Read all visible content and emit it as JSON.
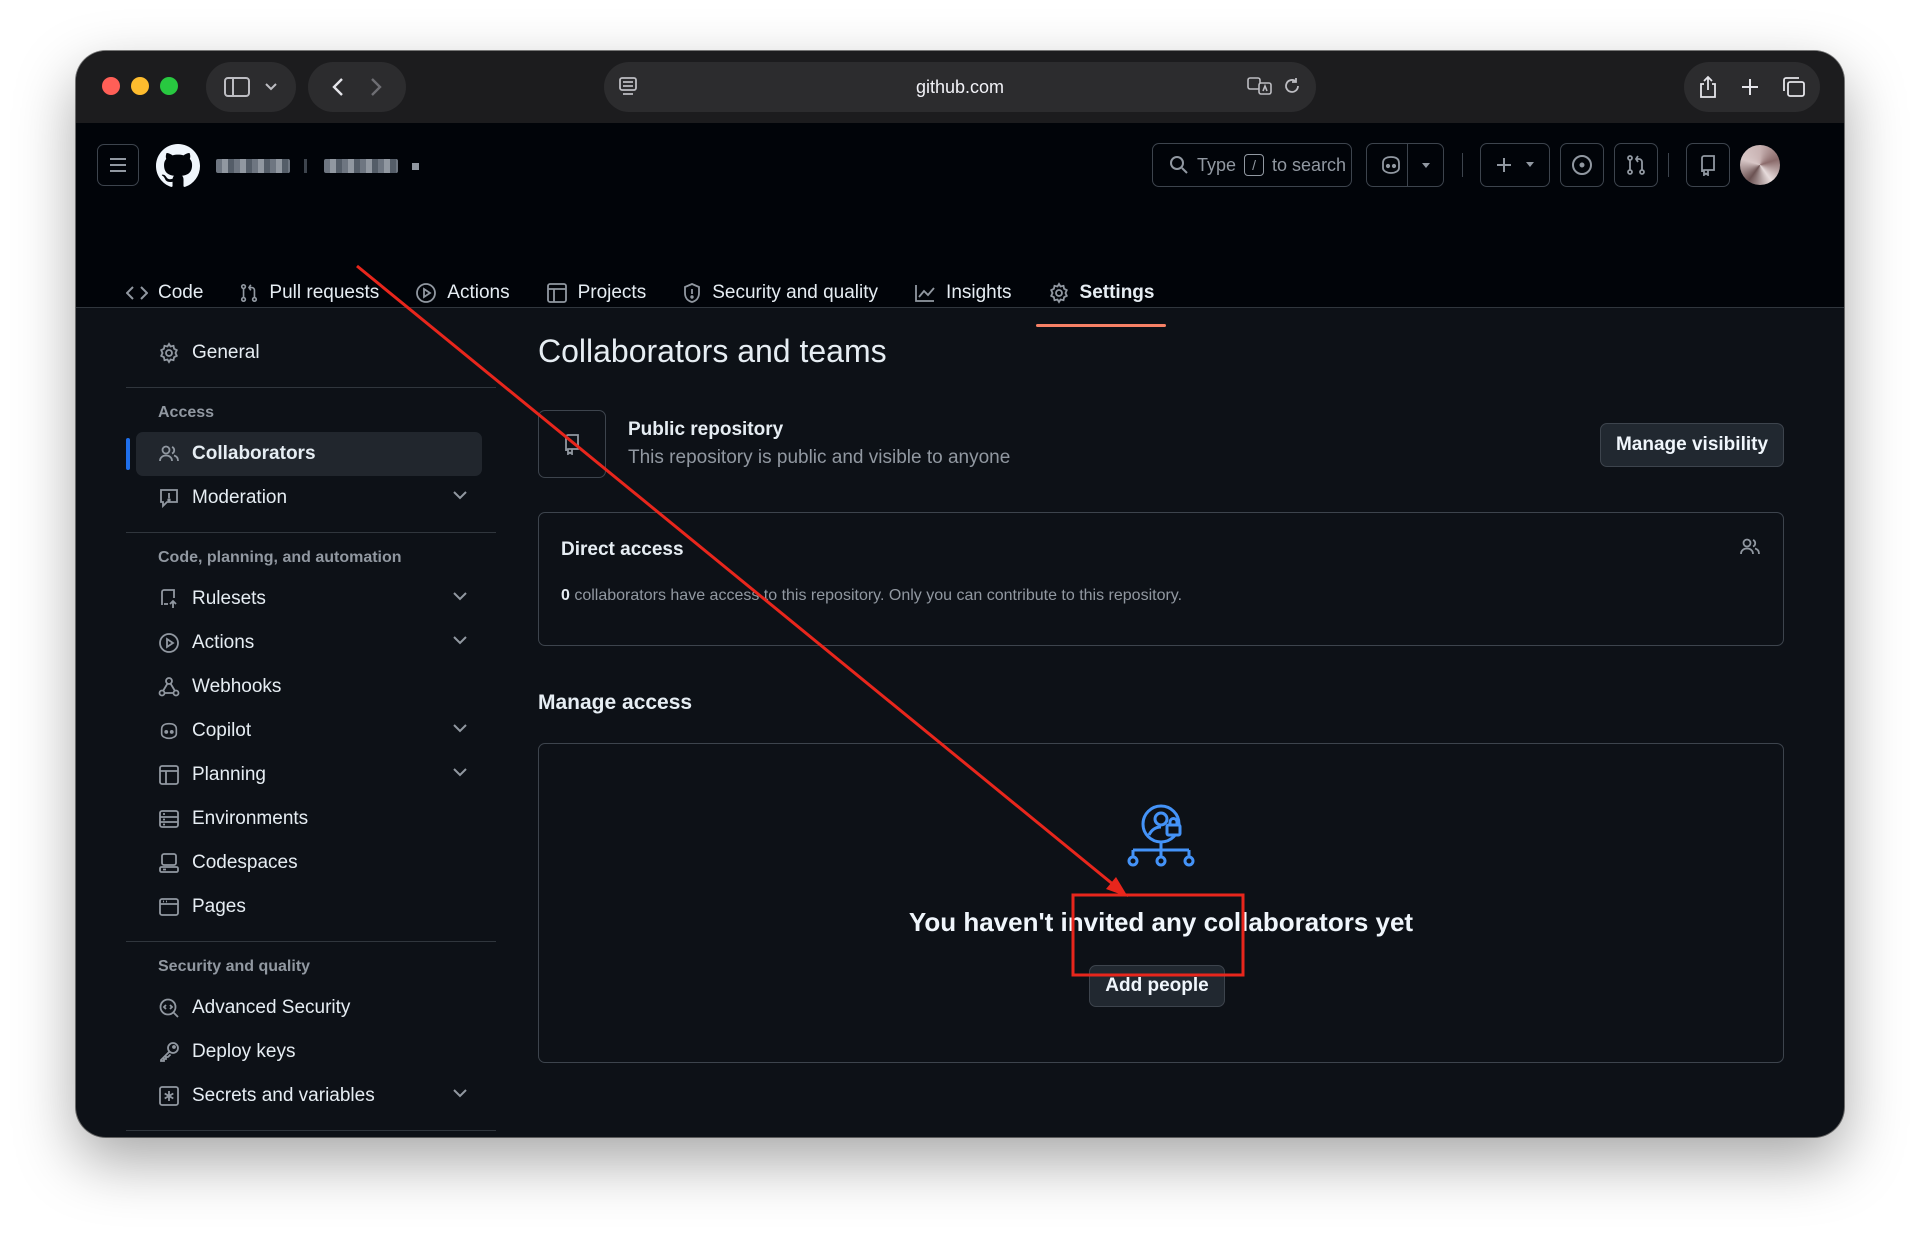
{
  "browser": {
    "url": "github.com"
  },
  "header": {
    "search_prefix": "Type",
    "search_key": "/",
    "search_suffix": "to search"
  },
  "tabs": [
    {
      "label": "Code",
      "icon": "code-icon"
    },
    {
      "label": "Pull requests",
      "icon": "pull-request-icon"
    },
    {
      "label": "Actions",
      "icon": "play-icon"
    },
    {
      "label": "Projects",
      "icon": "table-icon"
    },
    {
      "label": "Security and quality",
      "icon": "shield-icon"
    },
    {
      "label": "Insights",
      "icon": "graph-icon"
    },
    {
      "label": "Settings",
      "icon": "gear-icon",
      "active": true
    }
  ],
  "sidebar": {
    "general": "General",
    "access_heading": "Access",
    "collaborators": "Collaborators",
    "moderation": "Moderation",
    "code_heading": "Code, planning, and automation",
    "rulesets": "Rulesets",
    "actions": "Actions",
    "webhooks": "Webhooks",
    "copilot": "Copilot",
    "planning": "Planning",
    "environments": "Environments",
    "codespaces": "Codespaces",
    "pages": "Pages",
    "security_heading": "Security and quality",
    "advanced_security": "Advanced Security",
    "deploy_keys": "Deploy keys",
    "secrets": "Secrets and variables"
  },
  "main": {
    "title": "Collaborators and teams",
    "public_title": "Public repository",
    "public_desc": "This repository is public and visible to anyone",
    "manage_visibility": "Manage visibility",
    "direct_access_title": "Direct access",
    "direct_access_count": "0",
    "direct_access_desc": " collaborators have access to this repository. Only you can contribute to this repository.",
    "manage_access_title": "Manage access",
    "empty_title": "You haven't invited any collaborators yet",
    "add_people": "Add people"
  },
  "colors": {
    "accent_blue": "#4493f8",
    "tab_underline": "#f78166",
    "annotation_red": "#e8261c"
  }
}
